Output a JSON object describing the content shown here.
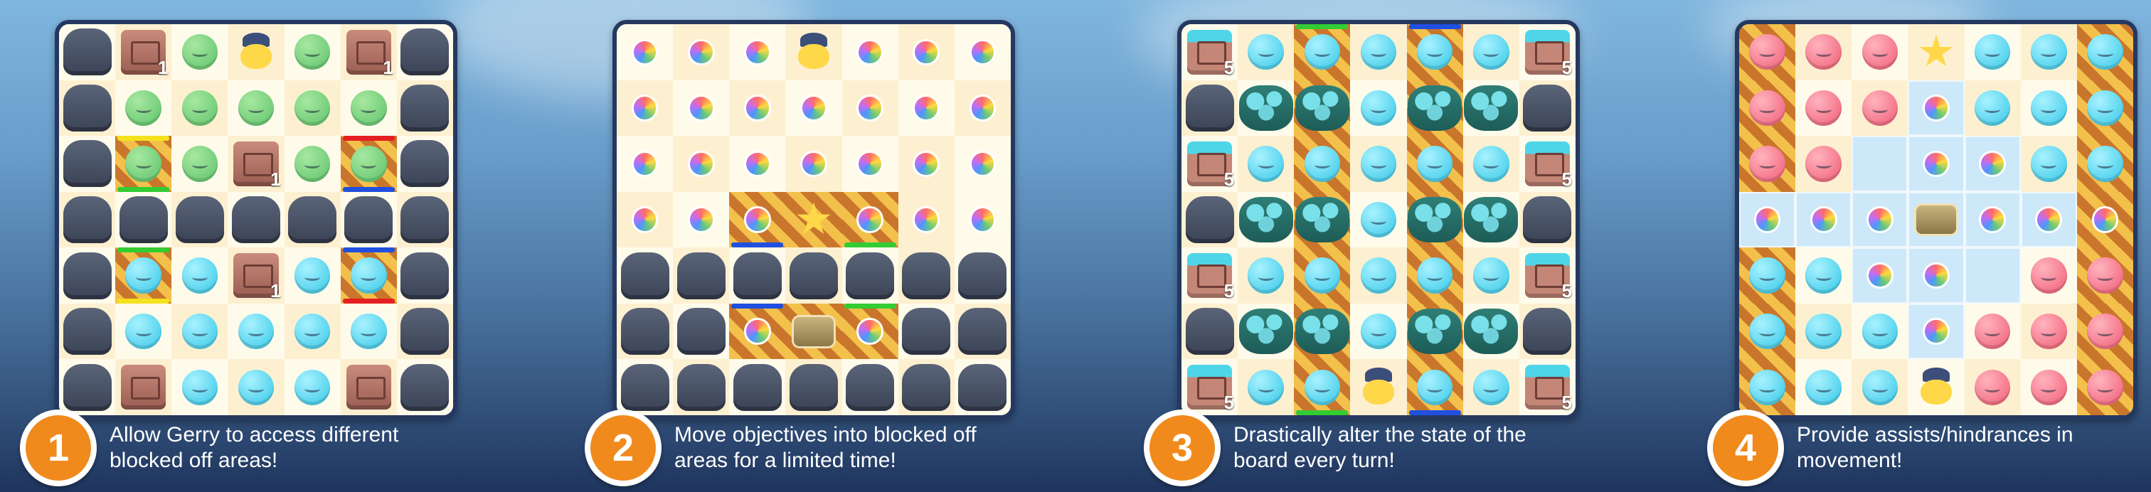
{
  "colors": {
    "badge": "#f08a1c",
    "panel_border": "#253860",
    "caption_text": "#ffffff"
  },
  "panels": [
    {
      "number": "1",
      "caption": "Allow Gerry to access different blocked off areas!",
      "crate_counts": [
        "1",
        "1",
        "1",
        "1"
      ]
    },
    {
      "number": "2",
      "caption": "Move objectives into blocked off areas for a limited time!",
      "crate_counts": []
    },
    {
      "number": "3",
      "caption": "Drastically alter the state of the board every turn!",
      "crate_counts": [
        "5",
        "5",
        "5",
        "5",
        "5",
        "5",
        "5",
        "5"
      ]
    },
    {
      "number": "4",
      "caption": "Provide assists/hindrances in movement!",
      "crate_counts": []
    }
  ]
}
